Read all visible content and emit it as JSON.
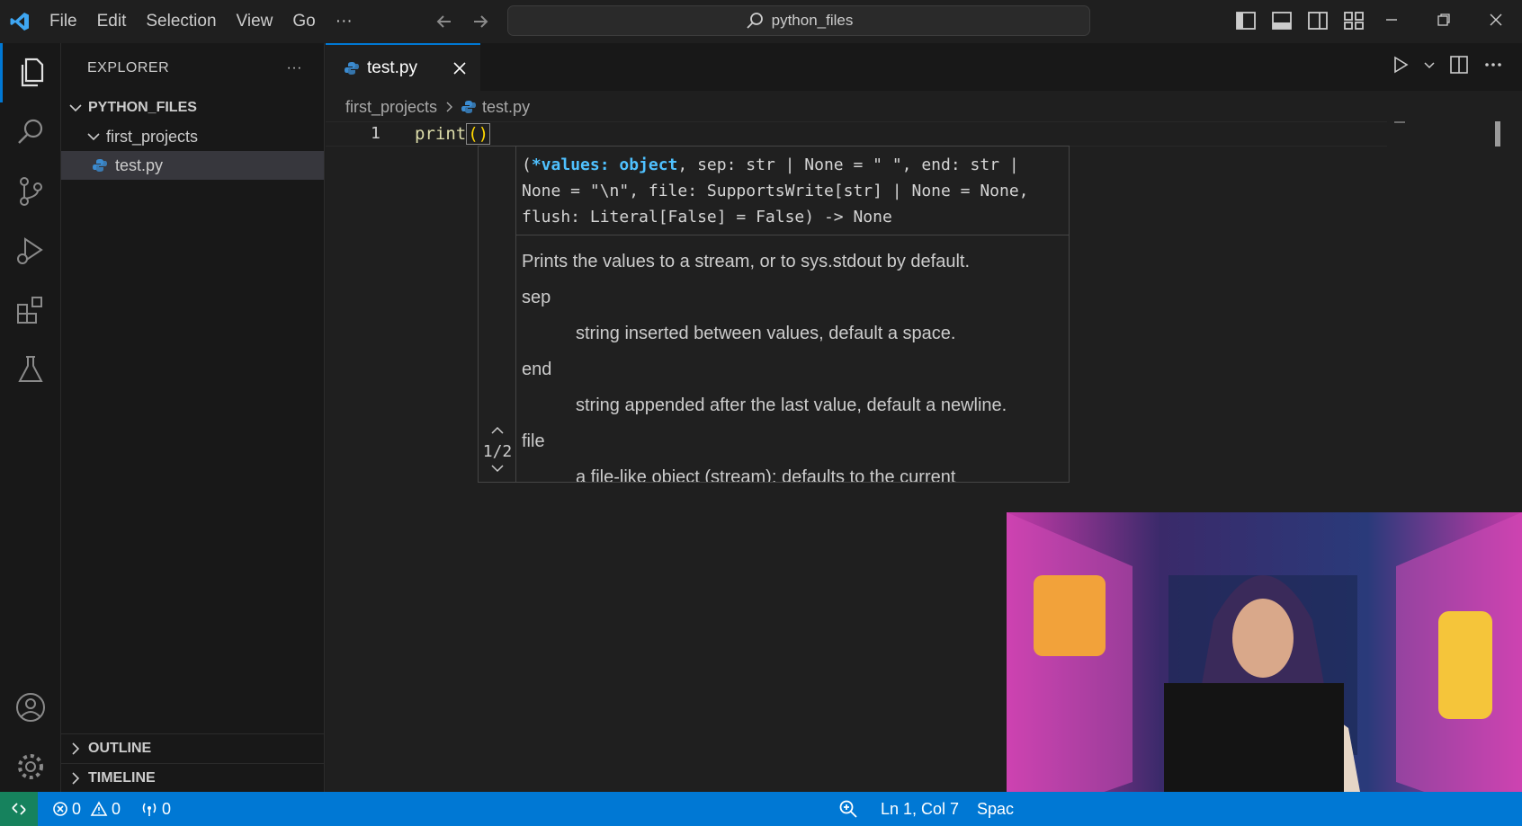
{
  "menu": [
    "File",
    "Edit",
    "Selection",
    "View",
    "Go",
    "···"
  ],
  "search": {
    "label": "python_files"
  },
  "explorer": {
    "title": "EXPLORER",
    "more": "···",
    "root": "PYTHON_FILES",
    "folder": "first_projects",
    "file": "test.py",
    "outline": "OUTLINE",
    "timeline": "TIMELINE"
  },
  "tab": {
    "label": "test.py"
  },
  "breadcrumb": {
    "folder": "first_projects",
    "file": "test.py"
  },
  "code": {
    "line_number": "1",
    "text": "print",
    "parens": "()"
  },
  "hover": {
    "sig_open": "(",
    "sig_kw": "*values: object",
    "sig_rest": ", sep: str | None = \" \", end: str | None = \"\\n\", file: SupportsWrite[str] | None = None, flush: Literal[False] = False) -> None",
    "summary": "Prints the values to a stream, or to sys.stdout by default.",
    "sep_name": "sep",
    "sep_desc": "string inserted between values, default a space.",
    "end_name": "end",
    "end_desc": "string appended after the last value, default a newline.",
    "file_name": "file",
    "file_desc": "a file-like object (stream); defaults to the current",
    "page": "1/2"
  },
  "status": {
    "errors": "0",
    "warnings": "0",
    "ports": "0",
    "position": "Ln 1, Col 7",
    "spaces": "Spac"
  },
  "colors": {
    "accent": "#0078d4",
    "remote": "#16825d"
  }
}
